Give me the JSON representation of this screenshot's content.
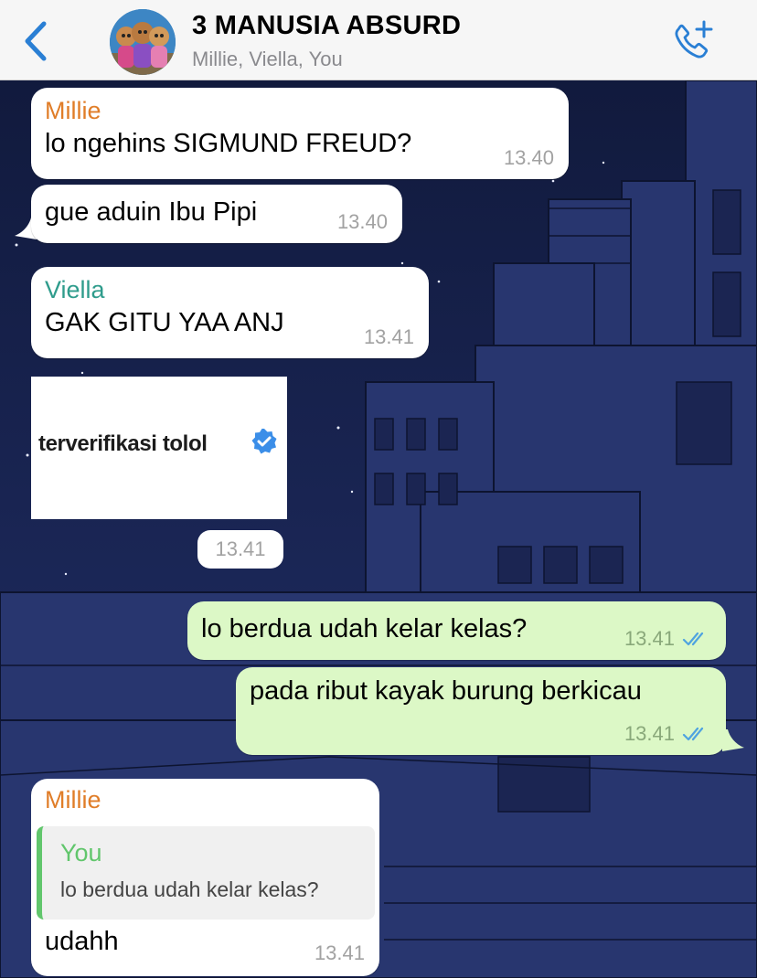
{
  "header": {
    "title": "3 MANUSIA ABSURD",
    "members": "Millie, Viella, You",
    "back_icon": "chevron-left-icon",
    "call_icon": "add-call-icon",
    "accent": "#2a7fd4"
  },
  "messages": [
    {
      "sender": "Millie",
      "text": "lo ngehins SIGMUND FREUD?",
      "time": "13.40",
      "direction": "in"
    },
    {
      "text": "gue aduin Ibu Pipi",
      "time": "13.40",
      "direction": "in"
    },
    {
      "sender": "Viella",
      "text": "GAK GITU YAA ANJ",
      "time": "13.41",
      "direction": "in"
    },
    {
      "type": "image",
      "image_text": "terverifikasi tolol",
      "icon": "verified-badge-icon",
      "time": "13.41",
      "direction": "in"
    },
    {
      "text": "lo berdua udah kelar kelas?",
      "time": "13.41",
      "direction": "out",
      "status": "read"
    },
    {
      "text": "pada ribut kayak burung berkicau",
      "time": "13.41",
      "direction": "out",
      "status": "read"
    },
    {
      "sender": "Millie",
      "reply_to": {
        "sender": "You",
        "text": "lo berdua udah kelar kelas?"
      },
      "text": "udahh",
      "time": "13.41",
      "direction": "in"
    }
  ],
  "colors": {
    "outgoing_bubble": "#dcf8c6",
    "incoming_bubble": "#ffffff",
    "sender_millie": "#e07d28",
    "sender_viella": "#2f9c8c",
    "sender_you": "#61c66c",
    "read_ticks": "#4fa3e0"
  }
}
